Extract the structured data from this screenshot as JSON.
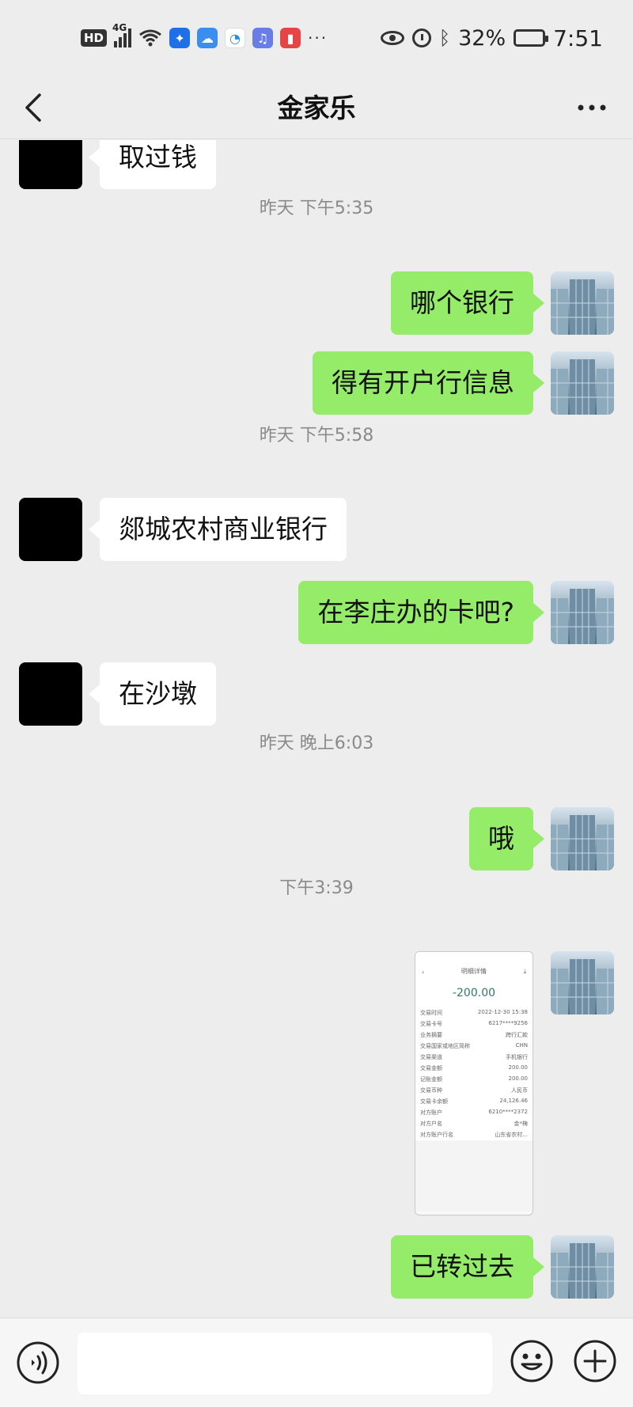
{
  "status_bar": {
    "hd": "HD",
    "network": "4G",
    "more": "···",
    "battery_percent": "32%",
    "battery_level": 0.32,
    "time": "7:51",
    "icons": [
      "hd-icon",
      "signal-icon",
      "wifi-icon",
      "bulb-app-icon",
      "cloud-app-icon",
      "chat-app-icon",
      "music-app-icon",
      "red-app-icon",
      "eye-icon",
      "alarm-icon",
      "bluetooth-icon",
      "battery-icon"
    ]
  },
  "nav": {
    "title": "金家乐",
    "back_icon": "chevron-left-icon",
    "more_icon": "more-icon"
  },
  "messages": [
    {
      "side": "left",
      "text": "取过钱"
    },
    {
      "type": "time",
      "text": "昨天 下午5:35"
    },
    {
      "side": "right",
      "text": "哪个银行"
    },
    {
      "side": "right",
      "text": "得有开户行信息"
    },
    {
      "type": "time",
      "text": "昨天 下午5:58"
    },
    {
      "side": "left",
      "text": "郯城农村商业银行"
    },
    {
      "side": "right",
      "text": "在李庄办的卡吧?"
    },
    {
      "side": "left",
      "text": "在沙墩"
    },
    {
      "type": "time",
      "text": "昨天 晚上6:03"
    },
    {
      "side": "right",
      "text": "哦"
    },
    {
      "type": "time",
      "text": "下午3:39"
    },
    {
      "side": "right",
      "type": "image",
      "image": {
        "title": "明细详情",
        "amount": "-200.00",
        "rows": [
          [
            "交易时间",
            "2022-12-30 15:38"
          ],
          [
            "交易卡号",
            "6217****9256"
          ],
          [
            "业务摘要",
            "跨行汇款"
          ],
          [
            "交易国家或地区简称",
            "CHN"
          ],
          [
            "交易渠道",
            "手机银行"
          ],
          [
            "交易金额",
            "200.00"
          ],
          [
            "记账金额",
            "200.00"
          ],
          [
            "交易币种",
            "人民币"
          ],
          [
            "交易卡余额",
            "24,126.46"
          ],
          [
            "对方账户",
            "6210****2372"
          ],
          [
            "对方户名",
            "金*梅"
          ],
          [
            "对方账户行名",
            "山东省农村..."
          ]
        ]
      }
    },
    {
      "side": "right",
      "text": "已转过去"
    }
  ],
  "input_bar": {
    "placeholder": "",
    "voice_icon": "voice-icon",
    "emoji_icon": "emoji-icon",
    "plus_icon": "plus-icon"
  },
  "colors": {
    "background": "#ededed",
    "bubble_self": "#95ec69",
    "bubble_other": "#ffffff",
    "timestamp": "#8a8a8a"
  }
}
